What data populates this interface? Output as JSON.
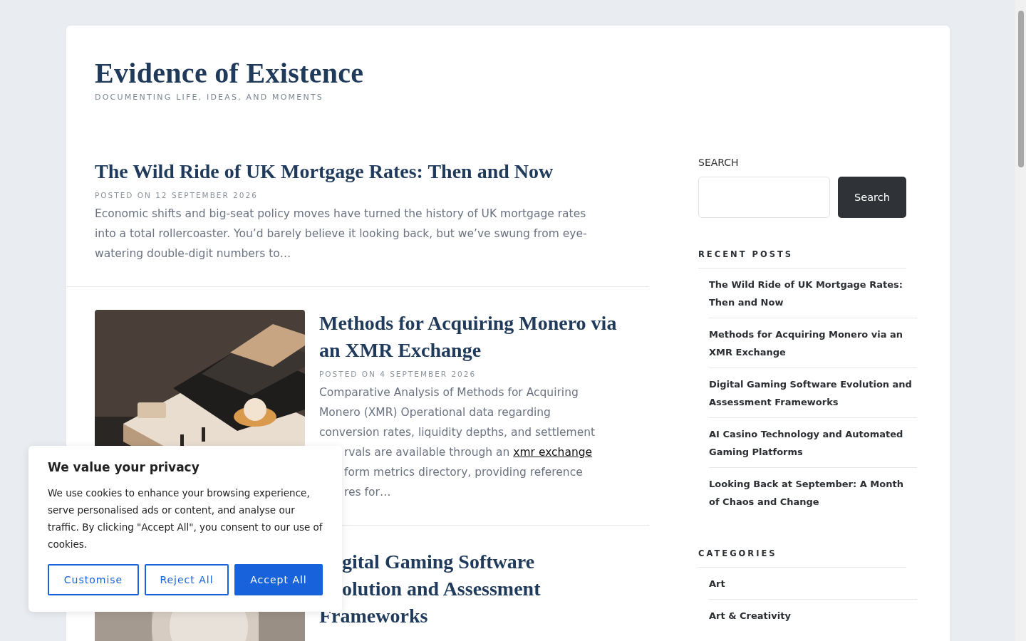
{
  "site": {
    "title": "Evidence of Existence",
    "tagline": "DOCUMENTING LIFE, IDEAS, AND MOMENTS"
  },
  "posts": [
    {
      "title_lines": [
        {
          "cut": false,
          "text": "The Wild Ride of UK Mortgage Rates: Then and Now"
        }
      ],
      "date": "POSTED ON 12 SEPTEMBER 2026",
      "excerpt_lines": [
        {
          "cut": false,
          "parts": [
            {
              "kind": "text",
              "text": "Economic shifts and big-seat policy moves have turned the history of UK mortgage rates into a total rollercoaster. You’d barely believe it looking back, but we’ve swung from eye-watering double-digit numbers to…"
            }
          ]
        }
      ]
    },
    {
      "title_lines": [
        {
          "cut": false,
          "text": "Methods for Acquiring Monero via an XMR Exchange"
        }
      ],
      "date": "POSTED ON 4 SEPTEMBER 2026",
      "image": {
        "kind": "picture"
      },
      "excerpt_lines": [
        {
          "cut": false,
          "parts": [
            {
              "kind": "text",
              "text": "Comparative Analysis of Methods for Acquiring"
            }
          ]
        },
        {
          "cut": false,
          "parts": [
            {
              "kind": "text",
              "text": "Monero (XMR) Operational data regarding"
            }
          ]
        },
        {
          "cut": false,
          "parts": [
            {
              "kind": "text",
              "text": "conversion rates, liquidity depths, and settlement"
            }
          ]
        },
        {
          "cut": true,
          "parts": [
            {
              "kind": "text",
              "text": "rvals are available through an "
            },
            {
              "kind": "link",
              "text": "xmr exchange"
            }
          ]
        },
        {
          "cut": true,
          "parts": [
            {
              "kind": "text",
              "text": "form metrics directory, providing reference"
            }
          ]
        },
        {
          "cut": true,
          "parts": [
            {
              "kind": "text",
              "text": "res for…"
            }
          ]
        }
      ]
    },
    {
      "title_lines": [
        {
          "cut": true,
          "text": "gital Gaming Software"
        },
        {
          "cut": true,
          "text": "olution and Assessment"
        },
        {
          "cut": false,
          "text": "Frameworks"
        }
      ],
      "image": {
        "kind": "picture"
      }
    }
  ],
  "sidebar": {
    "search": {
      "label": "SEARCH",
      "button": "Search"
    },
    "recent_posts": {
      "heading": "RECENT POSTS",
      "items": [
        "The Wild Ride of UK Mortgage Rates: Then and Now",
        "Methods for Acquiring Monero via an XMR Exchange",
        "Digital Gaming Software Evolution and Assessment Frameworks",
        "AI Casino Technology and Automated Gaming Platforms",
        "Looking Back at September: A Month of Chaos and Change"
      ]
    },
    "categories": {
      "heading": "CATEGORIES",
      "items": [
        "Art",
        "Art & Creativity"
      ]
    }
  },
  "cookie_banner": {
    "title": "We value your privacy",
    "text": "We use cookies to enhance your browsing experience, serve personalised ads or content, and analyse our traffic. By clicking \"Accept All\", you consent to our use of cookies.",
    "buttons": [
      {
        "label": "Customise",
        "kind": "outline"
      },
      {
        "label": "Reject All",
        "kind": "outline"
      },
      {
        "label": "Accept All",
        "kind": "primary"
      }
    ]
  }
}
